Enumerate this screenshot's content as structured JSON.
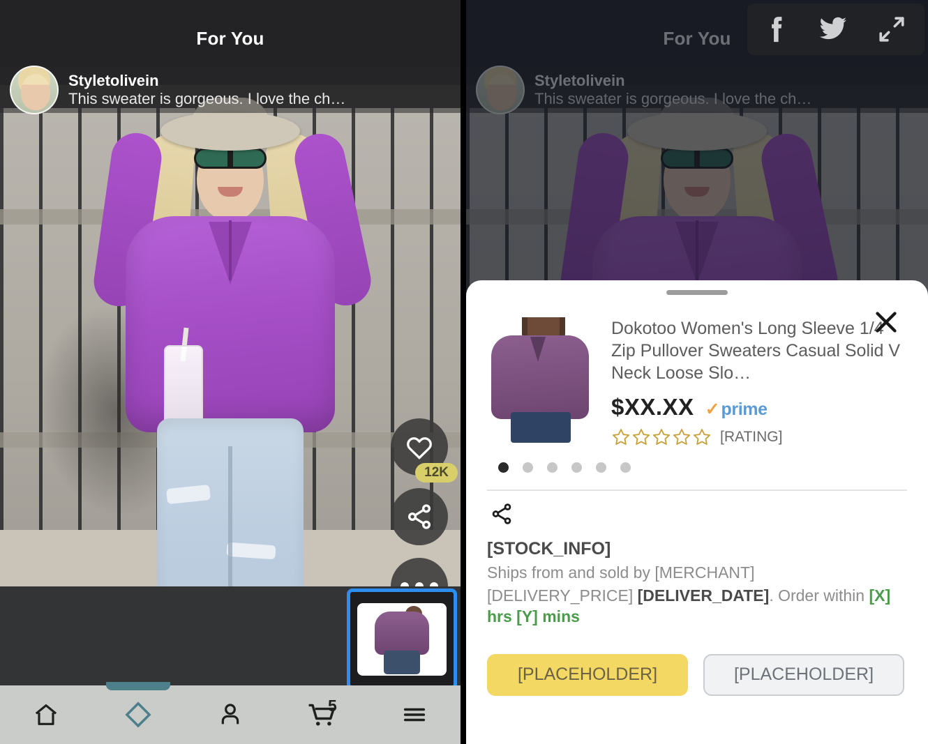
{
  "feed": {
    "title": "For You",
    "poster_name": "Styletolivein",
    "poster_caption": "This sweater is gorgeous. I love the ch…",
    "like_count": "12K",
    "icons": {
      "heart": "heart-icon",
      "share": "share-icon",
      "more": "more-options-icon",
      "avatar": "avatar"
    }
  },
  "nav": {
    "items": [
      {
        "name": "home",
        "label": "Home"
      },
      {
        "name": "inspire",
        "label": "Inspire"
      },
      {
        "name": "account",
        "label": "Account"
      },
      {
        "name": "cart",
        "label": "Cart"
      },
      {
        "name": "menu",
        "label": "Menu"
      }
    ],
    "cart_badge": "5",
    "active_index": 1
  },
  "social": {
    "facebook_label": "f",
    "twitter_label": "twitter-icon",
    "expand_label": "expand-icon"
  },
  "sheet": {
    "close_label": "✕",
    "product": {
      "title": "Dokotoo Women's Long Sleeve 1/4 Zip Pullover Sweaters Casual Solid V Neck Loose Slo…",
      "price": "$XX.XX",
      "prime_check": "✓",
      "prime_word": "prime",
      "rating_label": "[RATING]",
      "stars_total": 5,
      "stars_filled": 0,
      "carousel_dots": 6,
      "carousel_active": 0
    },
    "stock_info": "[STOCK_INFO]",
    "ships_line": "Ships from and sold by [MERCHANT]",
    "delivery_price": "[DELIVERY_PRICE]",
    "delivery_date": "[DELIVER_DATE]",
    "order_within_prefix": ". Order within ",
    "order_within_time": "[X] hrs [Y] mins",
    "primary_button": "[PLACEHOLDER]",
    "secondary_button": "[PLACEHOLDER]"
  },
  "colors": {
    "accent_blue": "#2d8df0",
    "primary_button": "#f3d864",
    "badge": "#d9cf6a",
    "nav_active": "#4d7f8b",
    "prime_blue": "#5a9bd5",
    "prime_orange": "#f0a23c",
    "green_text": "#4a9c4a",
    "star_gold": "#c8a23c"
  }
}
